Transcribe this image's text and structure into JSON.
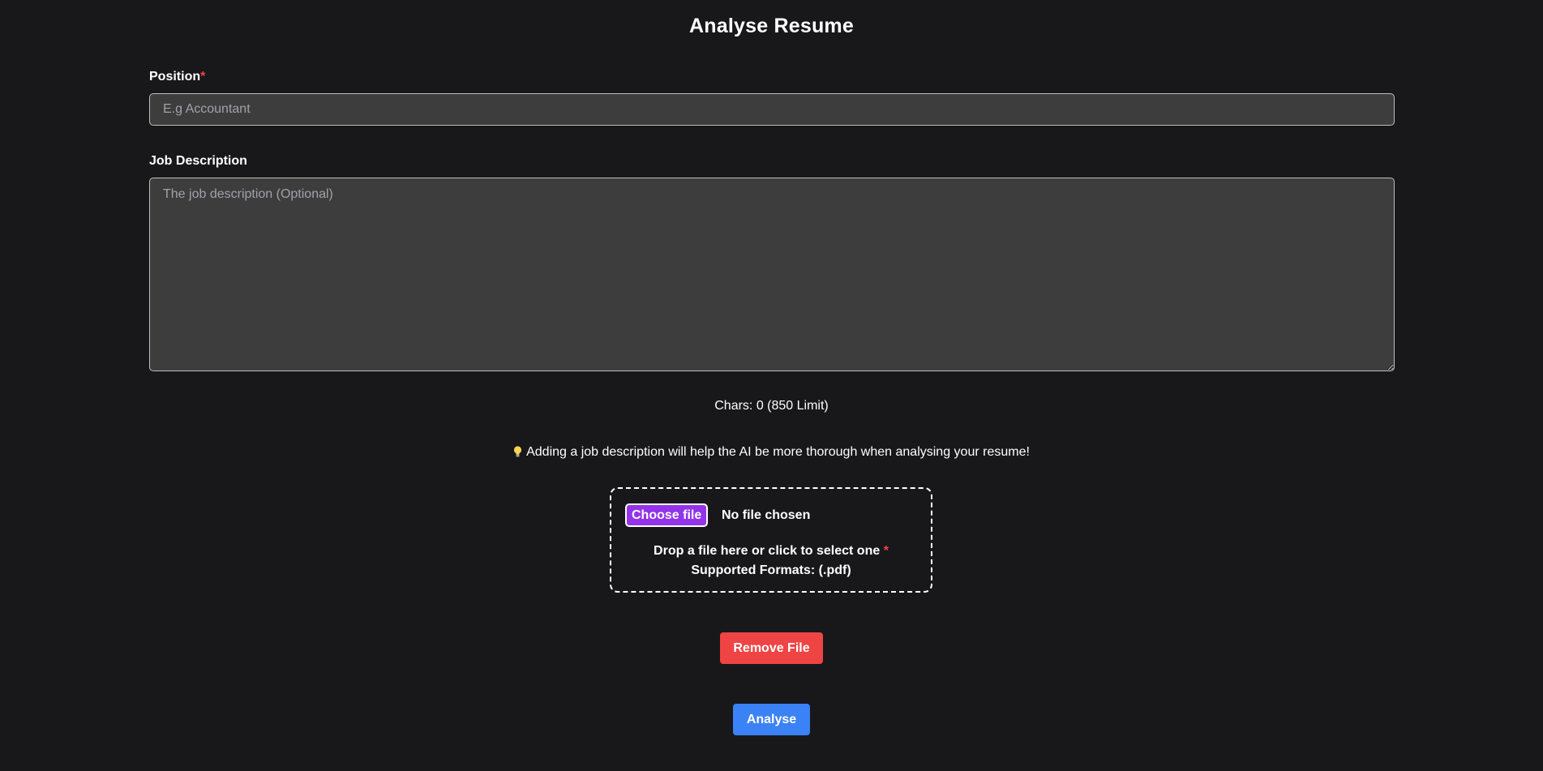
{
  "page": {
    "title": "Analyse Resume"
  },
  "position": {
    "label": "Position",
    "required_mark": "*",
    "placeholder": "E.g Accountant",
    "value": ""
  },
  "job_description": {
    "label": "Job Description",
    "placeholder": "The job description (Optional)",
    "value": ""
  },
  "char_counter": {
    "text": "Chars: 0 (850 Limit)"
  },
  "tip": {
    "icon": "lightbulb-icon",
    "text": "Adding a job description will help the AI be more thorough when analysing your resume!"
  },
  "file_upload": {
    "choose_label": "Choose file",
    "status": "No file chosen",
    "drop_text": "Drop a file here or click to select one",
    "required_mark": "*",
    "formats": "Supported Formats: (.pdf)"
  },
  "actions": {
    "remove_label": "Remove File",
    "analyse_label": "Analyse"
  },
  "colors": {
    "background": "#18181b",
    "input_background": "#3d3d3d",
    "required": "#ef4444",
    "choose_button": "#9333ea",
    "remove_button": "#ef4444",
    "analyse_button": "#3b82f6"
  }
}
